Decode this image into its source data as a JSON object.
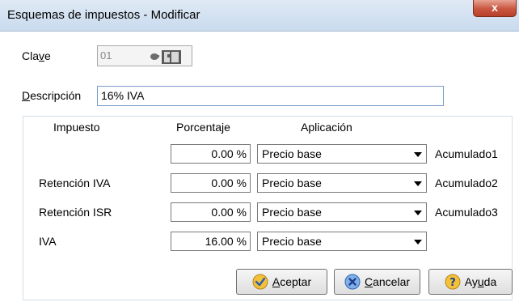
{
  "window": {
    "title": "Esquemas de impuestos - Modificar",
    "close_label": "x"
  },
  "clave": {
    "label_pre": "Cla",
    "label_ul": "v",
    "label_post": "e",
    "value": "01"
  },
  "descripcion": {
    "label_ul": "D",
    "label_rest": "escripción",
    "value": "16% IVA"
  },
  "table": {
    "headers": {
      "impuesto": "Impuesto",
      "porcentaje": "Porcentaje",
      "aplicacion": "Aplicación"
    },
    "rows": [
      {
        "impuesto": "",
        "porcentaje": "0.00 %",
        "aplicacion": "Precio base",
        "acumulado": "Acumulado1"
      },
      {
        "impuesto": "Retención IVA",
        "porcentaje": "0.00 %",
        "aplicacion": "Precio base",
        "acumulado": "Acumulado2"
      },
      {
        "impuesto": "Retención ISR",
        "porcentaje": "0.00 %",
        "aplicacion": "Precio base",
        "acumulado": "Acumulado3"
      },
      {
        "impuesto": "IVA",
        "porcentaje": "16.00 %",
        "aplicacion": "Precio base",
        "acumulado": ""
      }
    ]
  },
  "buttons": {
    "aceptar": {
      "ul": "A",
      "rest": "ceptar"
    },
    "cancelar": {
      "ul": "C",
      "rest": "ancelar"
    },
    "ayuda": {
      "pre": "Ay",
      "ul": "u",
      "post": "da"
    }
  }
}
